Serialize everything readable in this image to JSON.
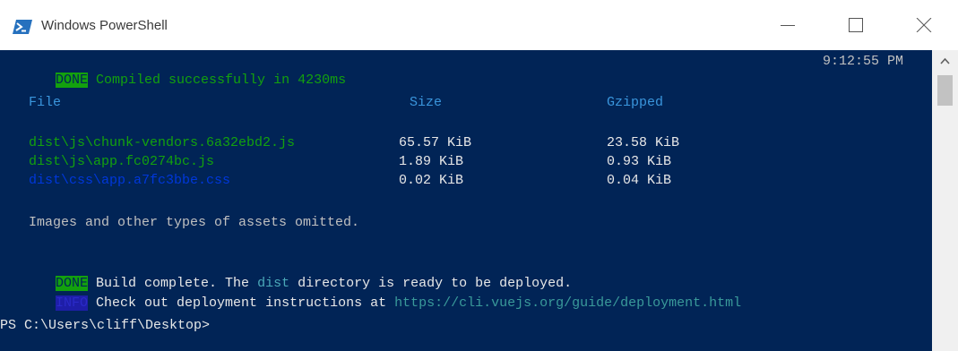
{
  "window": {
    "title": "Windows PowerShell",
    "icon": "powershell-icon"
  },
  "controls": {
    "minimize_icon": "minimize-icon",
    "maximize_icon": "maximize-icon",
    "close_icon": "close-icon"
  },
  "console": {
    "status_line": {
      "badge": "DONE",
      "message": " Compiled successfully in 4230ms",
      "time": "9:12:55 PM"
    },
    "table": {
      "headers": {
        "file": "File",
        "size": "Size",
        "gzipped": "Gzipped"
      },
      "rows": [
        {
          "file": "dist\\js\\chunk-vendors.6a32ebd2.js",
          "size": "65.57 KiB",
          "gzipped": "23.58 KiB"
        },
        {
          "file": "dist\\js\\app.fc0274bc.js",
          "size": "1.89 KiB",
          "gzipped": "0.93 KiB"
        },
        {
          "file": "dist\\css\\app.a7fc3bbe.css",
          "size": "0.02 KiB",
          "gzipped": "0.04 KiB"
        }
      ]
    },
    "omitted_note": "Images and other types of assets omitted.",
    "build_line": {
      "badge": "DONE",
      "prefix": " Build complete. The ",
      "dist": "dist",
      "suffix": " directory is ready to be deployed."
    },
    "info_line": {
      "badge": "INFO",
      "prefix": " Check out deployment instructions at ",
      "url": "https://cli.vuejs.org/guide/deployment.html"
    },
    "prompt": "PS C:\\Users\\cliff\\Desktop>"
  },
  "colors": {
    "console_bg": "#012456",
    "done_badge": "#13a10e",
    "info_badge": "#1e1ea8",
    "file_green": "#13a10e",
    "header_blue": "#3a96dd",
    "css_file_blue": "#0037da"
  }
}
